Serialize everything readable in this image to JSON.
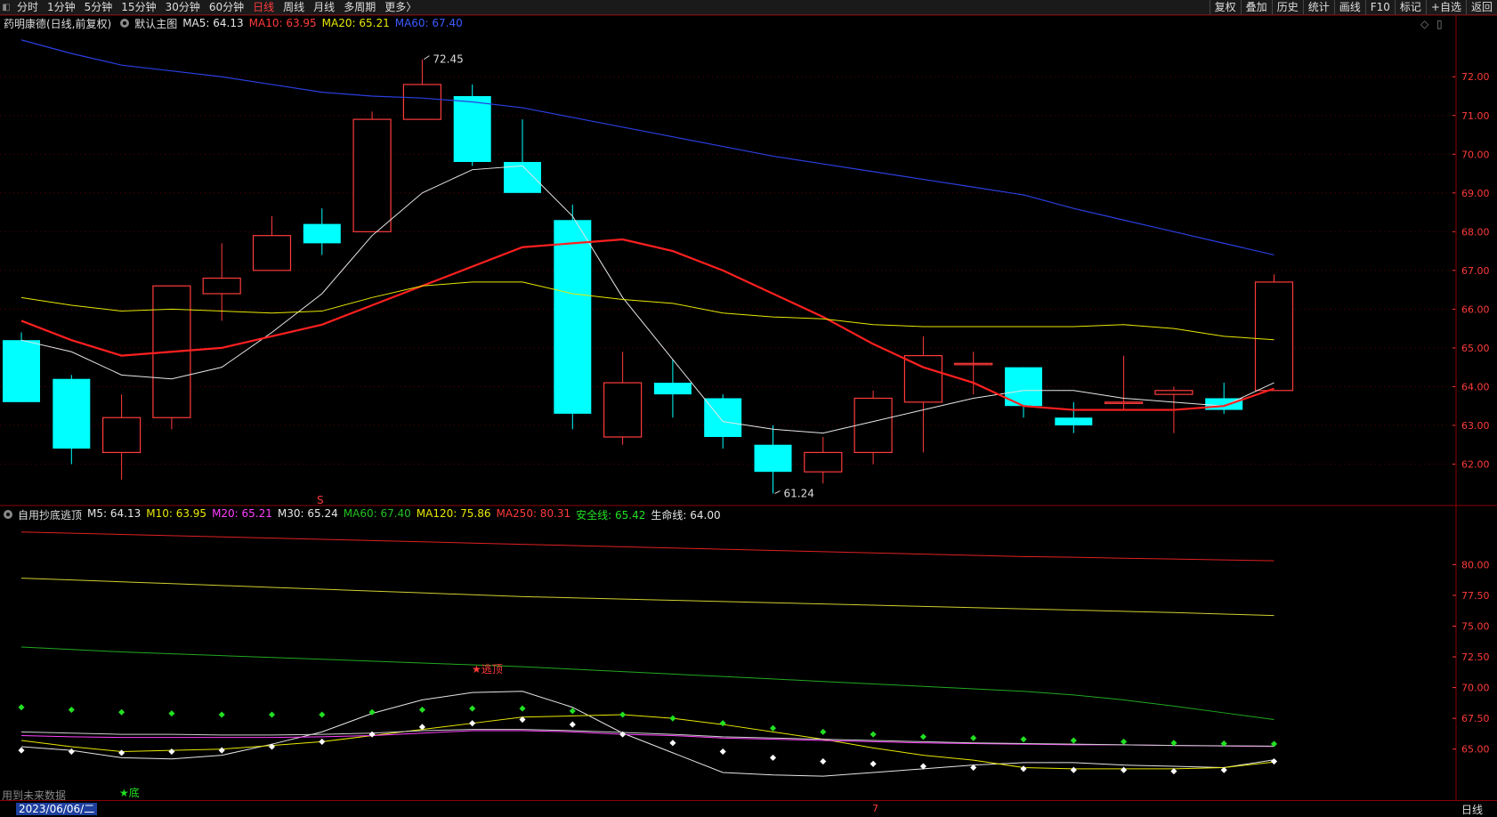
{
  "toolbar": {
    "periods": [
      {
        "label": "分时",
        "active": false
      },
      {
        "label": "1分钟",
        "active": false
      },
      {
        "label": "5分钟",
        "active": false
      },
      {
        "label": "15分钟",
        "active": false
      },
      {
        "label": "30分钟",
        "active": false
      },
      {
        "label": "60分钟",
        "active": false
      },
      {
        "label": "日线",
        "active": true
      },
      {
        "label": "周线",
        "active": false
      },
      {
        "label": "月线",
        "active": false
      },
      {
        "label": "多周期",
        "active": false
      },
      {
        "label": "更多〉",
        "active": false
      }
    ],
    "right_buttons": [
      "复权",
      "叠加",
      "历史",
      "统计",
      "画线",
      "F10",
      "标记",
      "+自选",
      "返回"
    ]
  },
  "main_legend": {
    "title": "药明康德(日线,前复权)",
    "indicator": "默认主图",
    "items": [
      {
        "text": "MA5: 64.13",
        "color": "#e6e6e6"
      },
      {
        "text": "MA10: 63.95",
        "color": "#ff3b3b"
      },
      {
        "text": "MA20: 65.21",
        "color": "#e8e800"
      },
      {
        "text": "MA60: 67.40",
        "color": "#3a5cff"
      }
    ]
  },
  "sub_legend": {
    "indicator": "自用抄底逃顶",
    "items": [
      {
        "text": "M5: 64.13",
        "color": "#e6e6e6"
      },
      {
        "text": "M10: 63.95",
        "color": "#e8e800"
      },
      {
        "text": "M20: 65.21",
        "color": "#ff40ff"
      },
      {
        "text": "M30: 65.24",
        "color": "#e6e6e6"
      },
      {
        "text": "MA60: 67.40",
        "color": "#22c022"
      },
      {
        "text": "MA120: 75.86",
        "color": "#e8e800"
      },
      {
        "text": "MA250: 80.31",
        "color": "#ff3b3b"
      },
      {
        "text": "安全线: 65.42",
        "color": "#22e022"
      },
      {
        "text": "生命线: 64.00",
        "color": "#e6e6e6"
      }
    ]
  },
  "markers": {
    "high_label": "72.45",
    "low_label": "61.24",
    "s_mark": "S",
    "escape_label": "★逃顶",
    "bottom_label": "★底"
  },
  "footer": {
    "future_note": "用到未来数据",
    "date": "2023/06/06/二",
    "tick_label": "7",
    "period": "日线"
  },
  "colors": {
    "up": "#ff3b3b",
    "down": "#00ffff",
    "ma5": "#e6e6e6",
    "ma10": "#ff2020",
    "ma20": "#e8e800",
    "ma60": "#2a3fe0"
  },
  "chart_data": [
    {
      "type": "candlestick",
      "title": "药明康德(日线,前复权)",
      "y_ticks": [
        62.0,
        63.0,
        64.0,
        65.0,
        66.0,
        67.0,
        68.0,
        69.0,
        70.0,
        71.0,
        72.0
      ],
      "ylim": [
        61.0,
        73.2
      ],
      "candles": [
        {
          "o": 65.2,
          "h": 65.4,
          "l": 63.6,
          "c": 63.6
        },
        {
          "o": 64.2,
          "h": 64.3,
          "l": 62.0,
          "c": 62.4
        },
        {
          "o": 62.3,
          "h": 63.8,
          "l": 61.6,
          "c": 63.2
        },
        {
          "o": 63.2,
          "h": 66.6,
          "l": 62.9,
          "c": 66.6
        },
        {
          "o": 66.4,
          "h": 67.7,
          "l": 65.7,
          "c": 66.8
        },
        {
          "o": 67.0,
          "h": 68.4,
          "l": 67.0,
          "c": 67.9
        },
        {
          "o": 68.2,
          "h": 68.6,
          "l": 67.4,
          "c": 67.7
        },
        {
          "o": 68.0,
          "h": 71.1,
          "l": 68.0,
          "c": 70.9
        },
        {
          "o": 70.9,
          "h": 72.45,
          "l": 70.9,
          "c": 71.8
        },
        {
          "o": 71.5,
          "h": 71.8,
          "l": 69.7,
          "c": 69.8
        },
        {
          "o": 69.8,
          "h": 70.9,
          "l": 69.0,
          "c": 69.0
        },
        {
          "o": 68.3,
          "h": 68.7,
          "l": 62.9,
          "c": 63.3
        },
        {
          "o": 62.7,
          "h": 64.9,
          "l": 62.5,
          "c": 64.1
        },
        {
          "o": 64.1,
          "h": 64.7,
          "l": 63.2,
          "c": 63.8
        },
        {
          "o": 63.7,
          "h": 63.8,
          "l": 62.4,
          "c": 62.7
        },
        {
          "o": 62.5,
          "h": 63.0,
          "l": 61.24,
          "c": 61.8
        },
        {
          "o": 61.8,
          "h": 62.7,
          "l": 61.5,
          "c": 62.3
        },
        {
          "o": 62.3,
          "h": 63.9,
          "l": 62.0,
          "c": 63.7
        },
        {
          "o": 63.6,
          "h": 65.3,
          "l": 62.3,
          "c": 64.8
        },
        {
          "o": 64.6,
          "h": 64.9,
          "l": 63.8,
          "c": 64.6
        },
        {
          "o": 64.5,
          "h": 64.5,
          "l": 63.2,
          "c": 63.5
        },
        {
          "o": 63.2,
          "h": 63.6,
          "l": 62.8,
          "c": 63.0
        },
        {
          "o": 63.6,
          "h": 64.8,
          "l": 63.4,
          "c": 63.6
        },
        {
          "o": 63.8,
          "h": 64.0,
          "l": 62.8,
          "c": 63.9
        },
        {
          "o": 63.7,
          "h": 64.1,
          "l": 63.3,
          "c": 63.4
        },
        {
          "o": 63.9,
          "h": 66.9,
          "l": 63.9,
          "c": 66.7
        }
      ],
      "series": [
        {
          "name": "MA5",
          "values": [
            65.2,
            64.9,
            64.3,
            64.2,
            64.5,
            65.4,
            66.4,
            67.9,
            69.0,
            69.6,
            69.7,
            68.4,
            66.3,
            64.7,
            63.1,
            62.9,
            62.8,
            63.1,
            63.4,
            63.7,
            63.9,
            63.9,
            63.7,
            63.6,
            63.5,
            64.1
          ]
        },
        {
          "name": "MA10",
          "values": [
            65.7,
            65.2,
            64.8,
            64.9,
            65.0,
            65.3,
            65.6,
            66.1,
            66.6,
            67.1,
            67.6,
            67.7,
            67.8,
            67.5,
            67.0,
            66.4,
            65.8,
            65.1,
            64.5,
            64.1,
            63.5,
            63.4,
            63.4,
            63.4,
            63.5,
            63.95
          ]
        },
        {
          "name": "MA20",
          "values": [
            66.3,
            66.1,
            65.95,
            66.0,
            65.95,
            65.9,
            65.95,
            66.3,
            66.6,
            66.7,
            66.7,
            66.4,
            66.25,
            66.15,
            65.9,
            65.8,
            65.75,
            65.6,
            65.55,
            65.55,
            65.55,
            65.55,
            65.6,
            65.5,
            65.3,
            65.21
          ]
        },
        {
          "name": "MA60",
          "values": [
            72.95,
            72.6,
            72.3,
            72.15,
            72.0,
            71.8,
            71.6,
            71.5,
            71.45,
            71.35,
            71.2,
            70.95,
            70.7,
            70.45,
            70.2,
            69.95,
            69.75,
            69.55,
            69.35,
            69.15,
            68.95,
            68.6,
            68.3,
            68.0,
            67.7,
            67.4
          ]
        }
      ]
    },
    {
      "type": "line",
      "title": "自用抄底逃顶",
      "y_ticks": [
        65.0,
        67.5,
        70.0,
        72.5,
        75.0,
        77.5,
        80.0
      ],
      "ylim": [
        61.0,
        83.5
      ],
      "series": [
        {
          "name": "M5",
          "values": [
            65.2,
            64.9,
            64.3,
            64.2,
            64.5,
            65.4,
            66.4,
            67.9,
            69.0,
            69.6,
            69.7,
            68.4,
            66.3,
            64.7,
            63.1,
            62.9,
            62.8,
            63.1,
            63.4,
            63.7,
            63.9,
            63.9,
            63.7,
            63.6,
            63.5,
            64.13
          ]
        },
        {
          "name": "M10",
          "values": [
            65.7,
            65.2,
            64.8,
            64.9,
            65.0,
            65.3,
            65.6,
            66.1,
            66.6,
            67.1,
            67.6,
            67.7,
            67.8,
            67.5,
            67.0,
            66.4,
            65.8,
            65.1,
            64.5,
            64.1,
            63.5,
            63.4,
            63.4,
            63.4,
            63.5,
            63.95
          ]
        },
        {
          "name": "M20",
          "values": [
            66.1,
            66.0,
            65.95,
            65.95,
            65.95,
            65.95,
            66.0,
            66.1,
            66.3,
            66.5,
            66.5,
            66.4,
            66.2,
            66.1,
            65.9,
            65.8,
            65.7,
            65.6,
            65.5,
            65.45,
            65.4,
            65.35,
            65.35,
            65.3,
            65.25,
            65.21
          ]
        },
        {
          "name": "M30",
          "values": [
            66.4,
            66.3,
            66.2,
            66.2,
            66.15,
            66.15,
            66.2,
            66.3,
            66.5,
            66.6,
            66.6,
            66.5,
            66.35,
            66.2,
            66.0,
            65.9,
            65.8,
            65.7,
            65.6,
            65.5,
            65.45,
            65.4,
            65.35,
            65.3,
            65.27,
            65.24
          ]
        },
        {
          "name": "MA60",
          "values": [
            73.3,
            73.1,
            72.9,
            72.75,
            72.6,
            72.45,
            72.3,
            72.15,
            72.0,
            71.85,
            71.7,
            71.5,
            71.3,
            71.1,
            70.9,
            70.7,
            70.5,
            70.3,
            70.1,
            69.9,
            69.7,
            69.4,
            69.0,
            68.5,
            67.95,
            67.4
          ]
        },
        {
          "name": "MA120",
          "values": [
            78.9,
            78.75,
            78.6,
            78.45,
            78.3,
            78.15,
            78.0,
            77.85,
            77.7,
            77.55,
            77.4,
            77.3,
            77.2,
            77.1,
            77.0,
            76.9,
            76.8,
            76.7,
            76.6,
            76.5,
            76.4,
            76.3,
            76.2,
            76.1,
            75.98,
            75.86
          ]
        },
        {
          "name": "MA250",
          "values": [
            82.65,
            82.55,
            82.45,
            82.35,
            82.25,
            82.15,
            82.05,
            81.95,
            81.85,
            81.75,
            81.65,
            81.55,
            81.45,
            81.35,
            81.25,
            81.15,
            81.05,
            80.95,
            80.85,
            80.75,
            80.65,
            80.6,
            80.52,
            80.45,
            80.38,
            80.31
          ]
        },
        {
          "name": "安全线",
          "values": [
            68.4,
            68.2,
            68.0,
            67.9,
            67.8,
            67.8,
            67.8,
            68.0,
            68.2,
            68.3,
            68.3,
            68.1,
            67.8,
            67.5,
            67.1,
            66.7,
            66.4,
            66.2,
            66.0,
            65.9,
            65.8,
            65.7,
            65.6,
            65.5,
            65.45,
            65.42
          ]
        },
        {
          "name": "生命线",
          "values": [
            64.9,
            64.8,
            64.7,
            64.8,
            64.9,
            65.2,
            65.6,
            66.2,
            66.8,
            67.1,
            67.4,
            67.0,
            66.2,
            65.5,
            64.8,
            64.3,
            64.0,
            63.8,
            63.6,
            63.5,
            63.4,
            63.3,
            63.3,
            63.2,
            63.3,
            64.0
          ]
        }
      ]
    }
  ]
}
